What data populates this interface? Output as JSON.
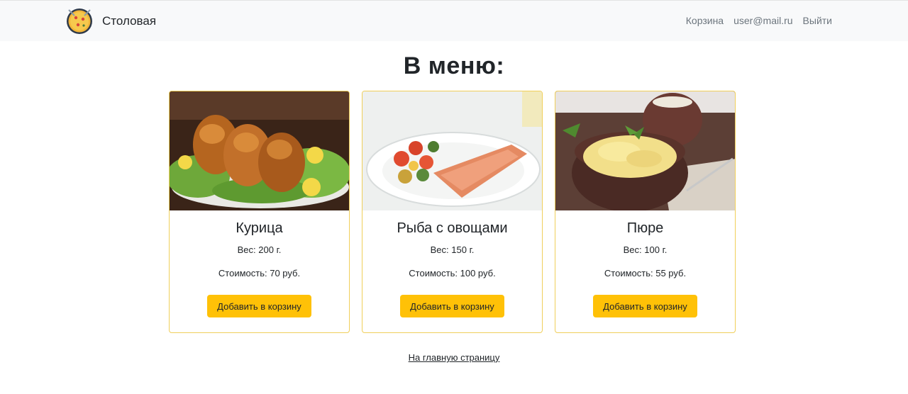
{
  "header": {
    "brand": "Столовая",
    "links": {
      "cart": "Корзина",
      "user": "user@mail.ru",
      "logout": "Выйти"
    }
  },
  "main": {
    "heading": "В меню:",
    "items": [
      {
        "title": "Курица",
        "weight": "Вес: 200 г.",
        "price": "Стоимость: 70 руб.",
        "button": "Добавить в корзину"
      },
      {
        "title": "Рыба с овощами",
        "weight": "Вес: 150 г.",
        "price": "Стоимость: 100 руб.",
        "button": "Добавить в корзину"
      },
      {
        "title": "Пюре",
        "weight": "Вес: 100 г.",
        "price": "Стоимость: 55 руб.",
        "button": "Добавить в корзину"
      }
    ],
    "home_link": "На главную страницу"
  },
  "colors": {
    "navbar_bg": "#f8f9fa",
    "accent_button": "#ffc107",
    "card_border": "#f0cf5a",
    "muted_link": "#6c757d"
  },
  "icons": {
    "logo": "pizza-logo-icon"
  }
}
